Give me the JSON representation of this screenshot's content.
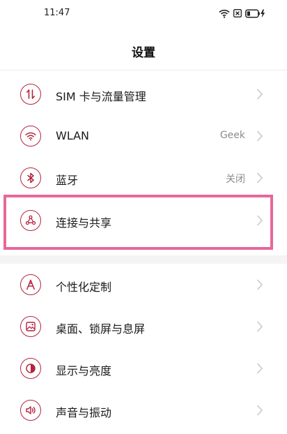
{
  "status_bar": {
    "time": "11:47",
    "battery_level": 0.3,
    "icons": [
      "wifi-icon",
      "sim-card-off-icon",
      "battery-charging-icon"
    ]
  },
  "title": "设置",
  "accent_color": "#b3243e",
  "highlight_color": "#e8679a",
  "settings": [
    {
      "label": "SIM 卡与流量管理",
      "value": "",
      "icon": "sim-data-transfer-icon"
    },
    {
      "label": "WLAN",
      "value": "Geek",
      "icon": "wifi-icon"
    },
    {
      "label": "蓝牙",
      "value": "关闭",
      "icon": "bluetooth-icon"
    },
    {
      "label": "连接与共享",
      "value": "",
      "icon": "connection-sharing-icon",
      "highlighted": true
    },
    {
      "label": "个性化定制",
      "value": "",
      "icon": "personalization-icon"
    },
    {
      "label": "桌面、锁屏与息屏",
      "value": "",
      "icon": "wallpaper-icon"
    },
    {
      "label": "显示与亮度",
      "value": "",
      "icon": "display-brightness-icon"
    },
    {
      "label": "声音与振动",
      "value": "",
      "icon": "sound-icon"
    }
  ]
}
